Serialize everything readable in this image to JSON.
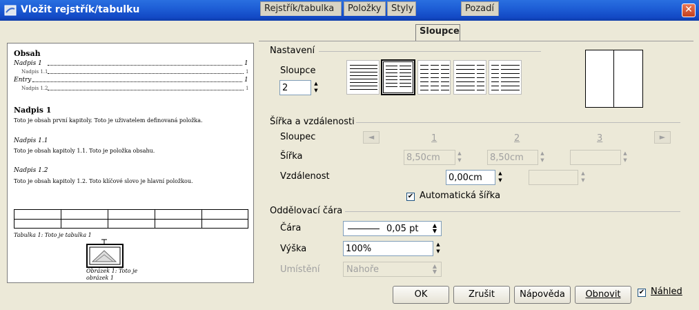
{
  "window": {
    "title": "Vložit rejstřík/tabulku",
    "close_symbol": "✕"
  },
  "preview": {
    "toc_title": "Obsah",
    "toc_entries": [
      {
        "text": "Nadpis 1",
        "page": "1"
      },
      {
        "text": "Nadpis 1.1",
        "page": "1"
      },
      {
        "text": "Entry",
        "page": "1"
      },
      {
        "text": "Nadpis 1.2",
        "page": "1"
      }
    ],
    "h1": "Nadpis 1",
    "p1": "Toto je obsah první kapitoly. Toto je uživatelem definovaná položka.",
    "h11": "Nadpis 1.1",
    "p11": "Toto je obsah kapitoly 1.1. Toto je položka obsahu.",
    "h12": "Nadpis 1.2",
    "p12": "Toto je obsah kapitoly 1.2. Toto klíčové slovo je hlavní položkou.",
    "table_caption": "Tabulka 1: Toto je tabulka 1",
    "figure_caption_1": "Obrázek 1: Toto je",
    "figure_caption_2": "obrázek 1"
  },
  "tabs": [
    {
      "label": "Rejstřík/tabulka",
      "active": false
    },
    {
      "label": "Položky",
      "active": false
    },
    {
      "label": "Styly",
      "active": false
    },
    {
      "label": "Sloupce",
      "active": true
    },
    {
      "label": "Pozadí",
      "active": false
    }
  ],
  "settings": {
    "header": "Nastavení",
    "columns_label": "Sloupce",
    "columns_value": "2",
    "layouts": [
      "1 column",
      "2 columns",
      "3 columns",
      "2 columns left wider",
      "2 columns right wider"
    ],
    "selected_layout": 1
  },
  "width_spacing": {
    "header": "Šířka a vzdálenosti",
    "column_label": "Sloupec",
    "col_numbers": [
      "1",
      "2",
      "3"
    ],
    "width_label": "Šířka",
    "width_values": [
      "8,50cm",
      "8,50cm",
      ""
    ],
    "spacing_label": "Vzdálenost",
    "spacing_values": [
      "0,00cm",
      ""
    ],
    "auto_width_label": "Automatická šířka",
    "auto_width_checked": true,
    "prev_arrow": "◄",
    "next_arrow": "►"
  },
  "separator": {
    "header": "Oddělovací čára",
    "line_label": "Čára",
    "line_value": "0,05 pt",
    "height_label": "Výška",
    "height_value": "100%",
    "position_label": "Umístění",
    "position_value": "Nahoře"
  },
  "buttons": {
    "ok": "OK",
    "cancel": "Zrušit",
    "help": "Nápověda",
    "reset": "Obnovit",
    "preview_label": "Náhled",
    "preview_checked": true
  }
}
